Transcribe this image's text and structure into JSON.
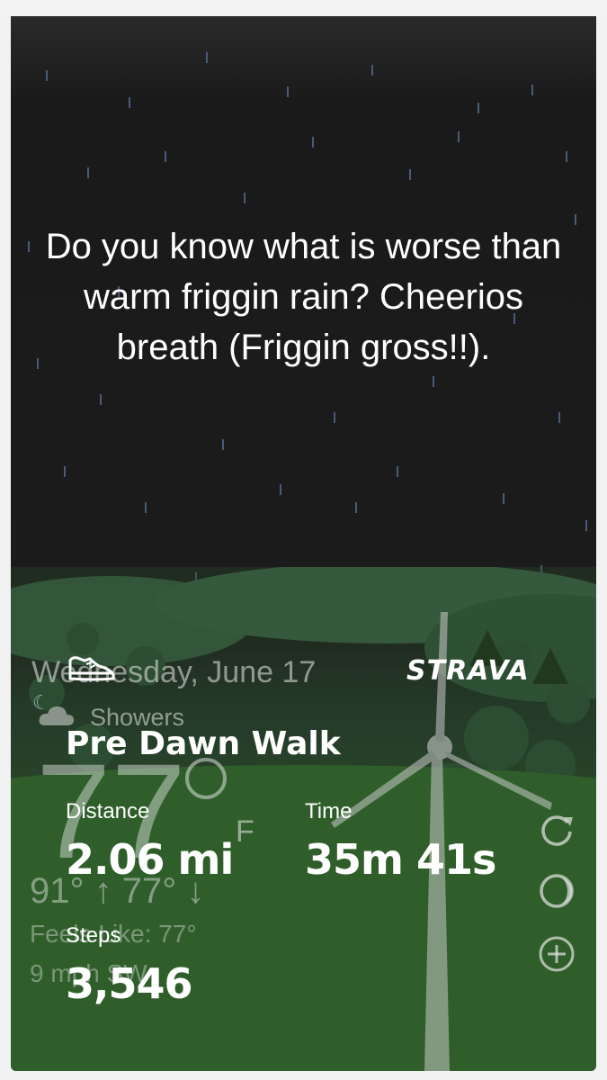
{
  "story": {
    "message": "Do you know what is worse than warm friggin rain? Cheerios breath (Friggin gross!!)."
  },
  "weather": {
    "date": "Wednesday, June 17",
    "condition": "Showers",
    "temperature": "77",
    "unit": "F",
    "high_low": "91° ↑  77° ↓",
    "feels_like": "Feels Like: 77°",
    "wind": "9 mph SW"
  },
  "strava": {
    "logo": "STRAVA",
    "activity_title": "Pre Dawn Walk",
    "stats": {
      "distance_label": "Distance",
      "distance_value": "2.06 mi",
      "time_label": "Time",
      "time_value": "35m 41s",
      "steps_label": "Steps",
      "steps_value": "3,546"
    }
  },
  "icons": [
    "shoe-icon",
    "refresh-icon",
    "moon-phase-icon",
    "add-icon",
    "cloud-icon",
    "moon-icon"
  ]
}
